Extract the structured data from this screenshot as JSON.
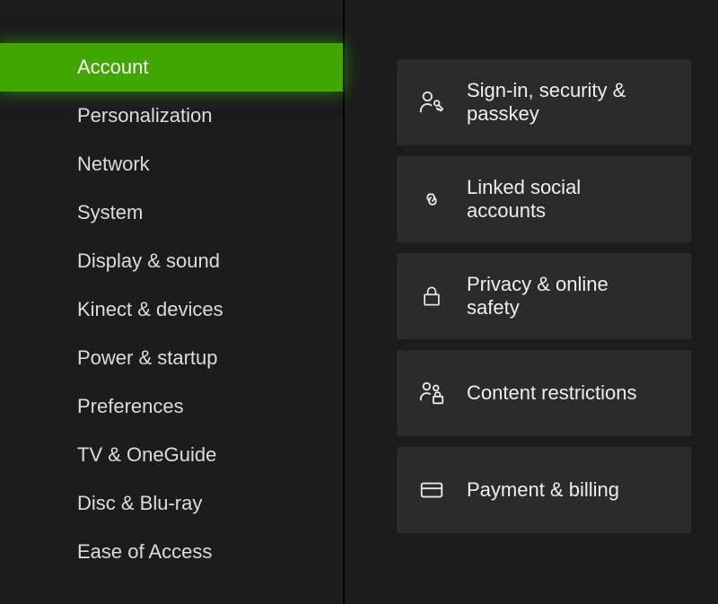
{
  "accent": "#3fa700",
  "sidebar": {
    "selected_index": 0,
    "items": [
      {
        "label": "Account"
      },
      {
        "label": "Personalization"
      },
      {
        "label": "Network"
      },
      {
        "label": "System"
      },
      {
        "label": "Display & sound"
      },
      {
        "label": "Kinect & devices"
      },
      {
        "label": "Power & startup"
      },
      {
        "label": "Preferences"
      },
      {
        "label": "TV & OneGuide"
      },
      {
        "label": "Disc & Blu-ray"
      },
      {
        "label": "Ease of Access"
      }
    ]
  },
  "tiles": [
    {
      "icon": "person-key-icon",
      "label": "Sign-in, security & passkey"
    },
    {
      "icon": "link-icon",
      "label": "Linked social accounts"
    },
    {
      "icon": "lock-icon",
      "label": "Privacy & online safety"
    },
    {
      "icon": "people-lock-icon",
      "label": "Content restrictions"
    },
    {
      "icon": "card-icon",
      "label": "Payment & billing"
    }
  ]
}
